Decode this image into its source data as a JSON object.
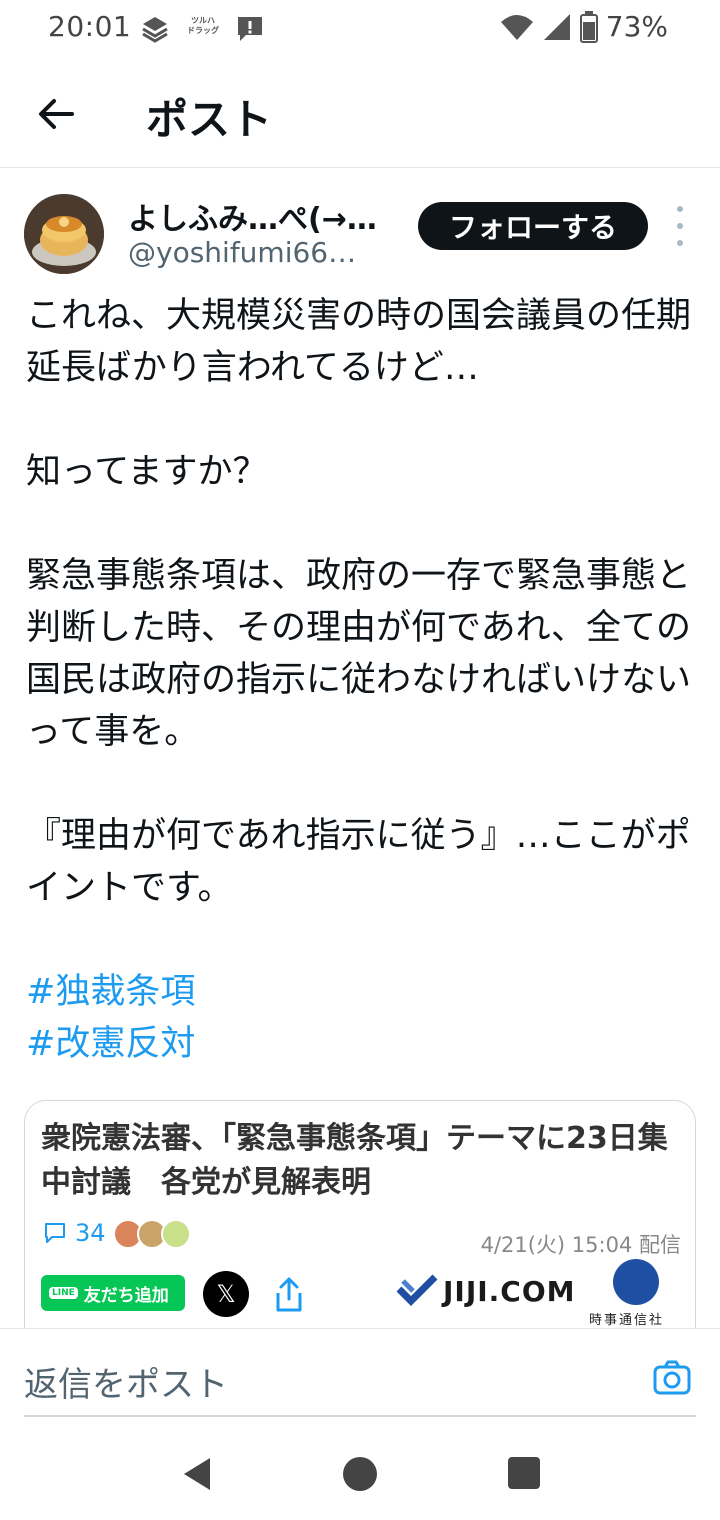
{
  "status_bar": {
    "time": "20:01",
    "app_badge": "ツルハ\nドラッグ",
    "battery": "73%"
  },
  "header": {
    "title": "ポスト"
  },
  "author": {
    "name": "よしふみ…ぺ(→…",
    "handle": "@yoshifumi66…",
    "follow_label": "フォローする"
  },
  "tweet": {
    "paragraphs": [
      "これね、大規模災害の時の国会議員の任期延長ばかり言われてるけど…",
      "知ってますか？",
      "緊急事態条項は、政府の一存で緊急事態と判断した時、その理由が何であれ、全ての国民は政府の指示に従わなければいけないって事を。",
      "『理由が何であれ指示に従う』…ここがポイントです。"
    ],
    "hashtags": [
      "#独裁条項",
      "#改憲反対"
    ]
  },
  "card": {
    "title": "衆院憲法審、「緊急事態条項」テーマに23日集中討議　各党が見解表明",
    "comment_count": "34",
    "date": "4/21(火) 15:04 配信",
    "line_button": "友だち追加",
    "line_badge": "LINE",
    "x_label": "𝕏",
    "source_logo": "JIJI.COM",
    "source_sub": "時事通信社"
  },
  "reply": {
    "placeholder": "返信をポスト"
  },
  "colors": {
    "accent": "#1d9bf0",
    "text": "#0f1419",
    "muted": "#536471",
    "line_green": "#06c755"
  }
}
